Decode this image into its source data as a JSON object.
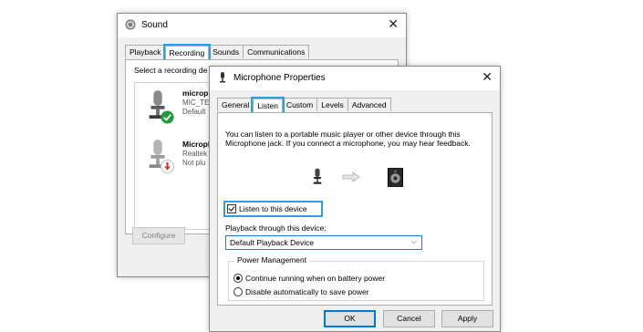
{
  "sound": {
    "title": "Sound",
    "close": "✕",
    "tabs": [
      "Playback",
      "Recording",
      "Sounds",
      "Communications"
    ],
    "instruction": "Select a recording de",
    "devices": [
      {
        "name": "micropl",
        "line1": "MIC_TES",
        "line2": "Default",
        "status": "default"
      },
      {
        "name": "Micropl",
        "line1": "Realtek",
        "line2": "Not plu",
        "status": "unplugged"
      }
    ],
    "configure": "Configure"
  },
  "props": {
    "title": "Microphone Properties",
    "close": "✕",
    "tabs": [
      "General",
      "Listen",
      "Custom",
      "Levels",
      "Advanced"
    ],
    "description": "You can listen to a portable music player or other device through this Microphone jack.  If you connect a microphone, you may hear feedback.",
    "listen_label": "Listen to this device",
    "listen_checked": true,
    "playback_label": "Playback through this device:",
    "playback_value": "Default Playback Device",
    "power_group": "Power Management",
    "power_options": [
      "Continue running when on battery power",
      "Disable automatically to save power"
    ],
    "power_selected": 0,
    "ok": "OK",
    "cancel": "Cancel",
    "apply": "Apply"
  },
  "colors": {
    "highlight": "#2aa0e8",
    "accent": "#0078d7",
    "ok_green": "#1e9e3a",
    "unplugged_red": "#d32f2f"
  }
}
